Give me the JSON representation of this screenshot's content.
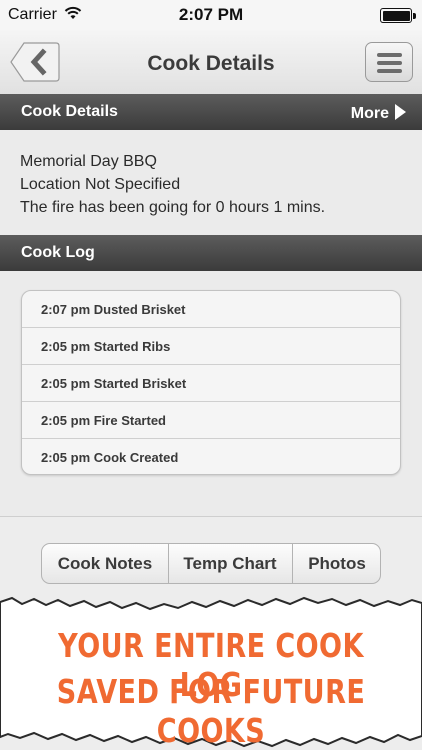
{
  "status_bar": {
    "carrier": "Carrier",
    "time": "2:07 PM"
  },
  "nav": {
    "title": "Cook Details",
    "back_icon": "chevron-left-icon",
    "menu_icon": "hamburger-icon"
  },
  "details_section": {
    "label": "Cook Details",
    "more_label": "More"
  },
  "details": {
    "name": "Memorial Day BBQ",
    "location": "Location Not Specified",
    "fire_status": "The fire has been going for 0 hours 1 mins."
  },
  "log_section": {
    "label": "Cook Log"
  },
  "cook_log": [
    "2:07 pm Dusted Brisket",
    "2:05 pm Started Ribs",
    "2:05 pm Started Brisket",
    "2:05 pm Fire Started",
    "2:05 pm Cook Created"
  ],
  "tabs": [
    "Cook Notes",
    "Temp Chart",
    "Photos"
  ],
  "promo": {
    "line1": "YOUR ENTIRE COOK LOG",
    "line2": "SAVED FOR FUTURE COOKS",
    "color": "#f06a32"
  }
}
